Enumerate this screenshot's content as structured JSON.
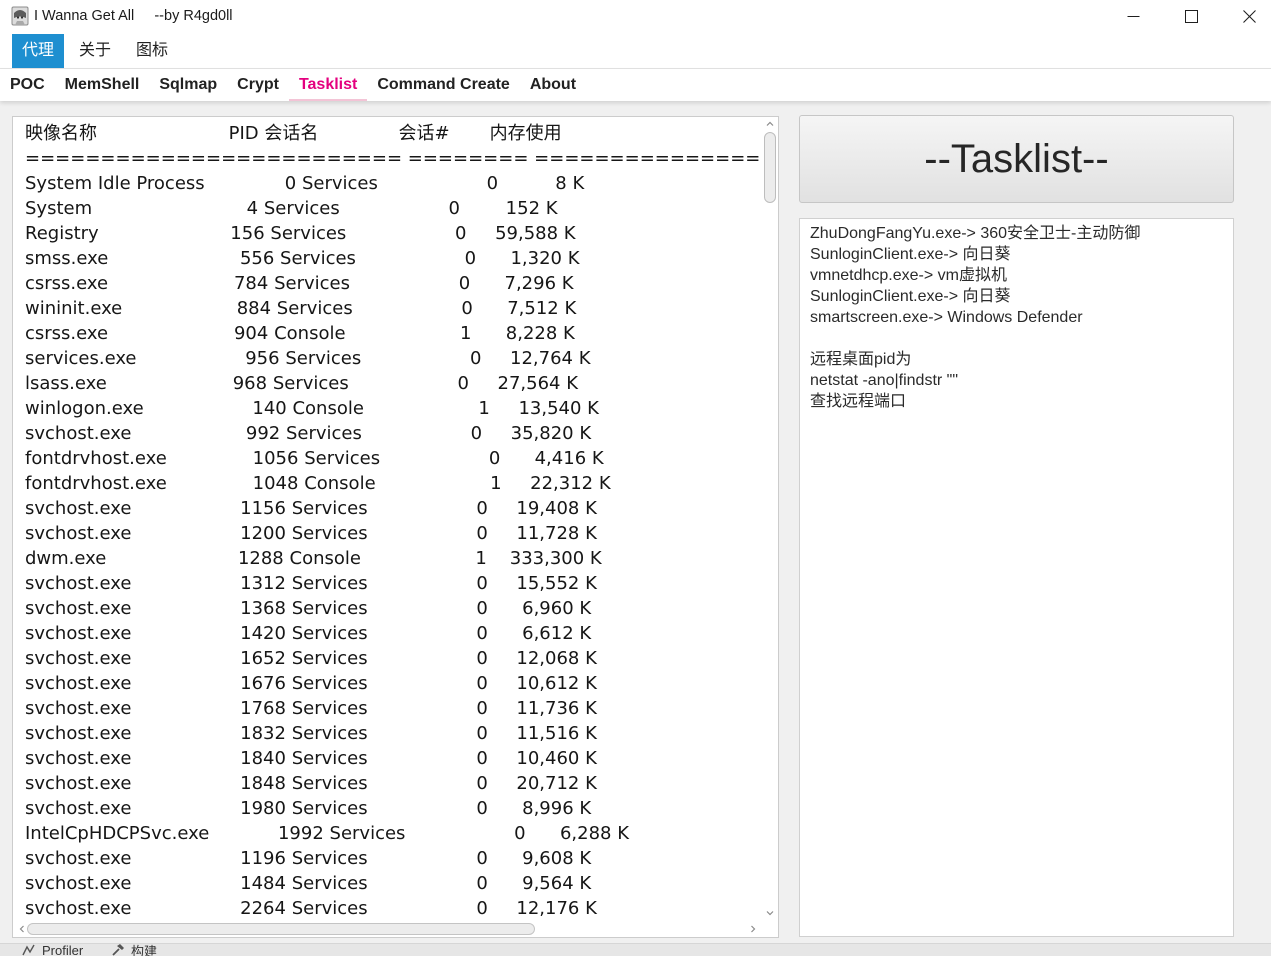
{
  "window": {
    "title": "I Wanna Get All     --by R4gd0ll",
    "icon": "app-icon",
    "controls": {
      "minimize_icon": "minimize-icon",
      "maximize_icon": "maximize-icon",
      "close_icon": "close-icon"
    }
  },
  "menu": {
    "items": [
      {
        "label": "代理",
        "active": true
      },
      {
        "label": "关于",
        "active": false
      },
      {
        "label": "图标",
        "active": false
      }
    ]
  },
  "tabs": [
    {
      "label": "POC",
      "active": false
    },
    {
      "label": "MemShell",
      "active": false
    },
    {
      "label": "Sqlmap",
      "active": false
    },
    {
      "label": "Crypt",
      "active": false
    },
    {
      "label": "Tasklist",
      "active": true
    },
    {
      "label": "Command Create",
      "active": false
    },
    {
      "label": "About",
      "active": false
    }
  ],
  "tasklist": {
    "columns": [
      "映像名称",
      "PID",
      "会话名",
      "会话#",
      "内存使用"
    ],
    "separator": "========================= ======== ================ =========== ============",
    "rows": [
      {
        "name": "System Idle Process",
        "pid": "0",
        "session": "Services",
        "session_no": "0",
        "mem": "8 K"
      },
      {
        "name": "System",
        "pid": "4",
        "session": "Services",
        "session_no": "0",
        "mem": "152 K"
      },
      {
        "name": "Registry",
        "pid": "156",
        "session": "Services",
        "session_no": "0",
        "mem": "59,588 K"
      },
      {
        "name": "smss.exe",
        "pid": "556",
        "session": "Services",
        "session_no": "0",
        "mem": "1,320 K"
      },
      {
        "name": "csrss.exe",
        "pid": "784",
        "session": "Services",
        "session_no": "0",
        "mem": "7,296 K"
      },
      {
        "name": "wininit.exe",
        "pid": "884",
        "session": "Services",
        "session_no": "0",
        "mem": "7,512 K"
      },
      {
        "name": "csrss.exe",
        "pid": "904",
        "session": "Console",
        "session_no": "1",
        "mem": "8,228 K"
      },
      {
        "name": "services.exe",
        "pid": "956",
        "session": "Services",
        "session_no": "0",
        "mem": "12,764 K"
      },
      {
        "name": "lsass.exe",
        "pid": "968",
        "session": "Services",
        "session_no": "0",
        "mem": "27,564 K"
      },
      {
        "name": "winlogon.exe",
        "pid": "140",
        "session": "Console",
        "session_no": "1",
        "mem": "13,540 K"
      },
      {
        "name": "svchost.exe",
        "pid": "992",
        "session": "Services",
        "session_no": "0",
        "mem": "35,820 K"
      },
      {
        "name": "fontdrvhost.exe",
        "pid": "1056",
        "session": "Services",
        "session_no": "0",
        "mem": "4,416 K"
      },
      {
        "name": "fontdrvhost.exe",
        "pid": "1048",
        "session": "Console",
        "session_no": "1",
        "mem": "22,312 K"
      },
      {
        "name": "svchost.exe",
        "pid": "1156",
        "session": "Services",
        "session_no": "0",
        "mem": "19,408 K"
      },
      {
        "name": "svchost.exe",
        "pid": "1200",
        "session": "Services",
        "session_no": "0",
        "mem": "11,728 K"
      },
      {
        "name": "dwm.exe",
        "pid": "1288",
        "session": "Console",
        "session_no": "1",
        "mem": "333,300 K"
      },
      {
        "name": "svchost.exe",
        "pid": "1312",
        "session": "Services",
        "session_no": "0",
        "mem": "15,552 K"
      },
      {
        "name": "svchost.exe",
        "pid": "1368",
        "session": "Services",
        "session_no": "0",
        "mem": "6,960 K"
      },
      {
        "name": "svchost.exe",
        "pid": "1420",
        "session": "Services",
        "session_no": "0",
        "mem": "6,612 K"
      },
      {
        "name": "svchost.exe",
        "pid": "1652",
        "session": "Services",
        "session_no": "0",
        "mem": "12,068 K"
      },
      {
        "name": "svchost.exe",
        "pid": "1676",
        "session": "Services",
        "session_no": "0",
        "mem": "10,612 K"
      },
      {
        "name": "svchost.exe",
        "pid": "1768",
        "session": "Services",
        "session_no": "0",
        "mem": "11,736 K"
      },
      {
        "name": "svchost.exe",
        "pid": "1832",
        "session": "Services",
        "session_no": "0",
        "mem": "11,516 K"
      },
      {
        "name": "svchost.exe",
        "pid": "1840",
        "session": "Services",
        "session_no": "0",
        "mem": "10,460 K"
      },
      {
        "name": "svchost.exe",
        "pid": "1848",
        "session": "Services",
        "session_no": "0",
        "mem": "20,712 K"
      },
      {
        "name": "svchost.exe",
        "pid": "1980",
        "session": "Services",
        "session_no": "0",
        "mem": "8,996 K"
      },
      {
        "name": "IntelCpHDCPSvc.exe",
        "pid": "1992",
        "session": "Services",
        "session_no": "0",
        "mem": "6,288 K"
      },
      {
        "name": "svchost.exe",
        "pid": "1196",
        "session": "Services",
        "session_no": "0",
        "mem": "9,608 K"
      },
      {
        "name": "svchost.exe",
        "pid": "1484",
        "session": "Services",
        "session_no": "0",
        "mem": "9,564 K"
      },
      {
        "name": "svchost.exe",
        "pid": "2264",
        "session": "Services",
        "session_no": "0",
        "mem": "12,176 K"
      }
    ]
  },
  "tasklist_button": {
    "label": "--Tasklist--"
  },
  "notes": {
    "lines": [
      "ZhuDongFangYu.exe-> 360安全卫士-主动防御",
      "SunloginClient.exe-> 向日葵",
      "vmnetdhcp.exe-> vm虚拟机",
      "SunloginClient.exe-> 向日葵",
      "smartscreen.exe-> Windows Defender",
      "",
      "远程桌面pid为",
      "netstat -ano|findstr \"\"",
      "查找远程端口"
    ]
  },
  "background_window": {
    "items": [
      {
        "icon": "profiler-icon",
        "label": "Profiler"
      },
      {
        "icon": "hammer-icon",
        "label": "构建"
      }
    ]
  },
  "colors": {
    "accent": "#1e8fd0",
    "tab_active": "#e4007f",
    "tab_underline": "#f3c4d6",
    "window_bg": "#f0f0f0"
  }
}
